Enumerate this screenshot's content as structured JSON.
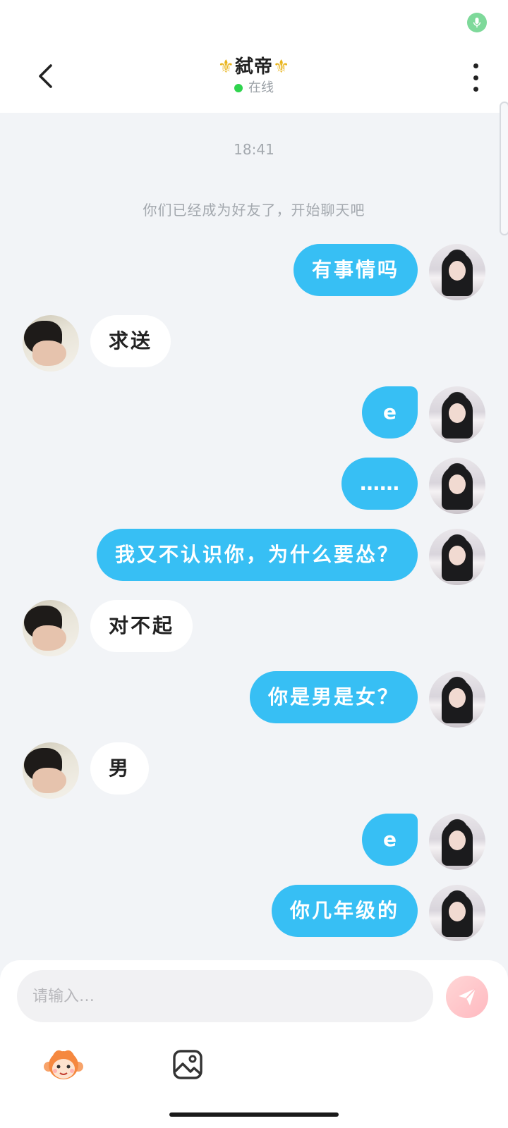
{
  "header": {
    "title_left_icon": "fleur-de-lis",
    "title_text": "弑帝",
    "title_right_icon": "fleur-de-lis",
    "status": "在线",
    "status_color": "#2fd44e"
  },
  "chat": {
    "timestamp": "18:41",
    "system_message": "你们已经成为好友了，开始聊天吧",
    "messages": [
      {
        "from": "me",
        "text": "有事情吗"
      },
      {
        "from": "them",
        "text": "求送"
      },
      {
        "from": "me",
        "text": "e"
      },
      {
        "from": "me",
        "text": "……"
      },
      {
        "from": "me",
        "text": "我又不认识你，为什么要怂？"
      },
      {
        "from": "them",
        "text": "对不起"
      },
      {
        "from": "me",
        "text": "你是男是女？"
      },
      {
        "from": "them",
        "text": "男"
      },
      {
        "from": "me",
        "text": "e"
      },
      {
        "from": "me",
        "text": "你几年级的"
      }
    ]
  },
  "input": {
    "placeholder": "请输入…"
  },
  "colors": {
    "my_bubble": "#37bff4",
    "their_bubble": "#ffffff",
    "background": "#f2f4f7"
  },
  "icons": {
    "back": "chevron-left-icon",
    "more": "more-vertical-icon",
    "send": "send-icon",
    "sticker": "monkey-sticker-icon",
    "image": "image-icon",
    "mic": "mic-icon"
  }
}
